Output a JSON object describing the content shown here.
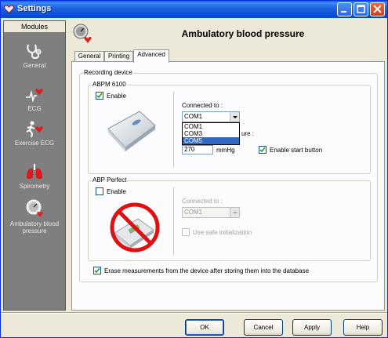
{
  "window": {
    "title": "Settings",
    "controls": [
      "minimize",
      "maximize",
      "close"
    ]
  },
  "sidebar": {
    "header": "Modules",
    "items": [
      {
        "label": "General",
        "icon": "stethoscope-icon"
      },
      {
        "label": "ECG",
        "icon": "ecg-heart-icon"
      },
      {
        "label": "Exercise ECG",
        "icon": "running-heart-icon"
      },
      {
        "label": "Spirometry",
        "icon": "lungs-icon"
      },
      {
        "label": "Ambulatory blood pressure",
        "icon": "blood-pressure-icon",
        "selected": true
      }
    ]
  },
  "page": {
    "title": "Ambulatory blood pressure",
    "icon": "blood-pressure-icon"
  },
  "tabs": [
    {
      "label": "General"
    },
    {
      "label": "Printing"
    },
    {
      "label": "Advanced",
      "active": true
    }
  ],
  "recording_device": {
    "legend": "Recording device",
    "abpm6100": {
      "legend": "ABPM 6100",
      "enable_label": "Enable",
      "enable_checked": true,
      "connected_label": "Connected to :",
      "port_value": "COM1",
      "port_options": [
        "COM1",
        "COM3",
        "COM5"
      ],
      "port_highlighted": "COM5",
      "pressure_label_partial": "ure :",
      "pressure_value": "270",
      "pressure_unit": "mmHg",
      "start_button_label": "Enable start button",
      "start_button_checked": true
    },
    "abp_perfect": {
      "legend": "ABP Perfect",
      "enable_label": "Enable",
      "enable_checked": false,
      "connected_label": "Connected to :",
      "port_value": "COM1",
      "safe_init_label": "Use safe initialization",
      "safe_init_checked": false
    },
    "erase_label": "Erase measurements from the device after storing them into the database",
    "erase_checked": true
  },
  "buttons": {
    "ok": "OK",
    "cancel": "Cancel",
    "apply": "Apply",
    "help": "Help"
  },
  "colors": {
    "titlebar": "#0a50d6",
    "sidebar": "#7f7f7f",
    "selection": "#316ac5",
    "prohibition": "#e01010"
  }
}
